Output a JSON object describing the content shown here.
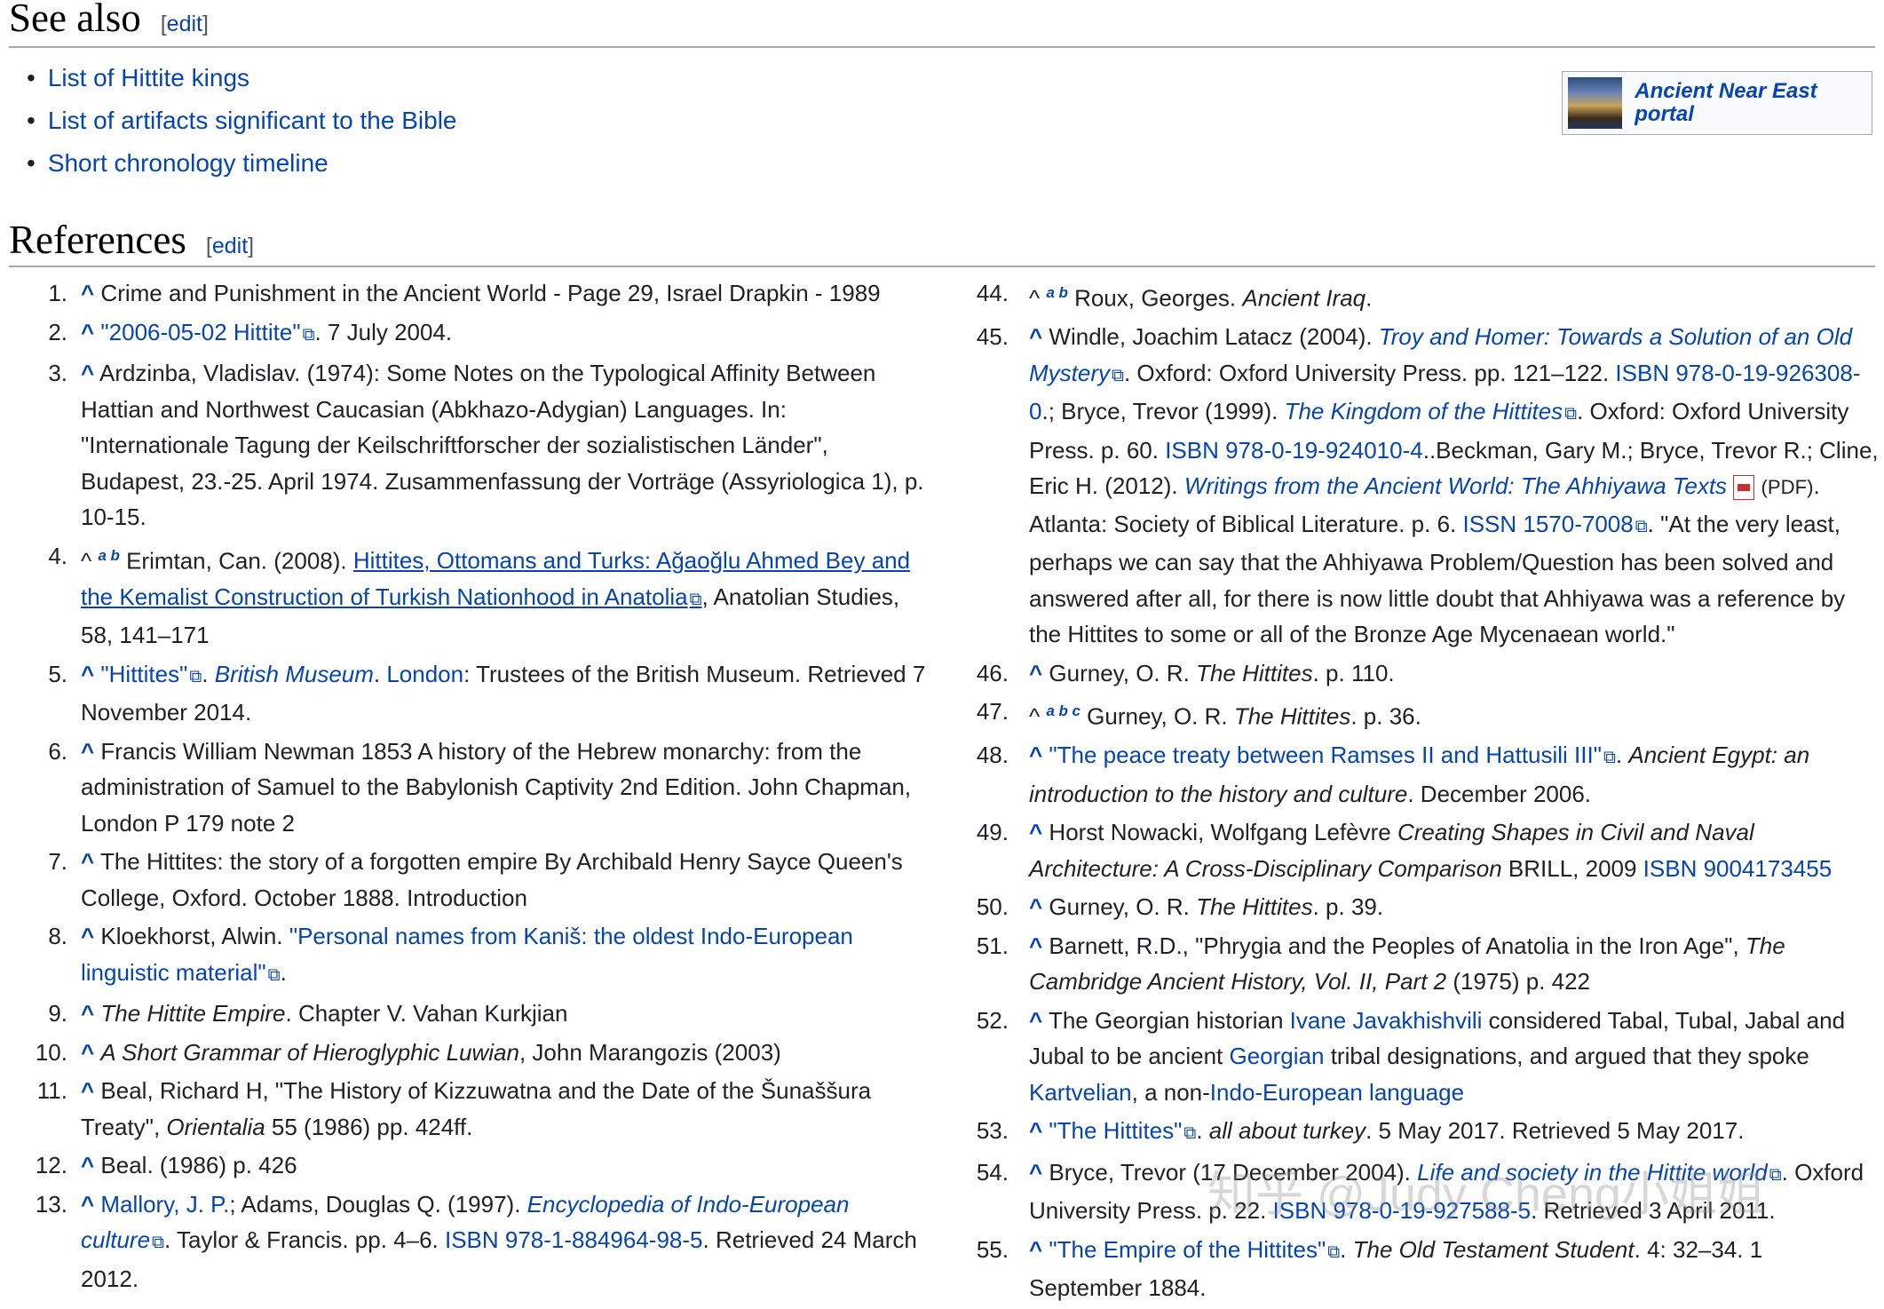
{
  "see_also": {
    "heading": "See also",
    "edit_label": "edit",
    "items": [
      "List of Hittite kings",
      "List of artifacts significant to the Bible",
      "Short chronology timeline"
    ],
    "portal_label": "Ancient Near East portal"
  },
  "references": {
    "heading": "References",
    "edit_label": "edit"
  },
  "watermark": "知乎 @Judy Cheng小姐姐"
}
